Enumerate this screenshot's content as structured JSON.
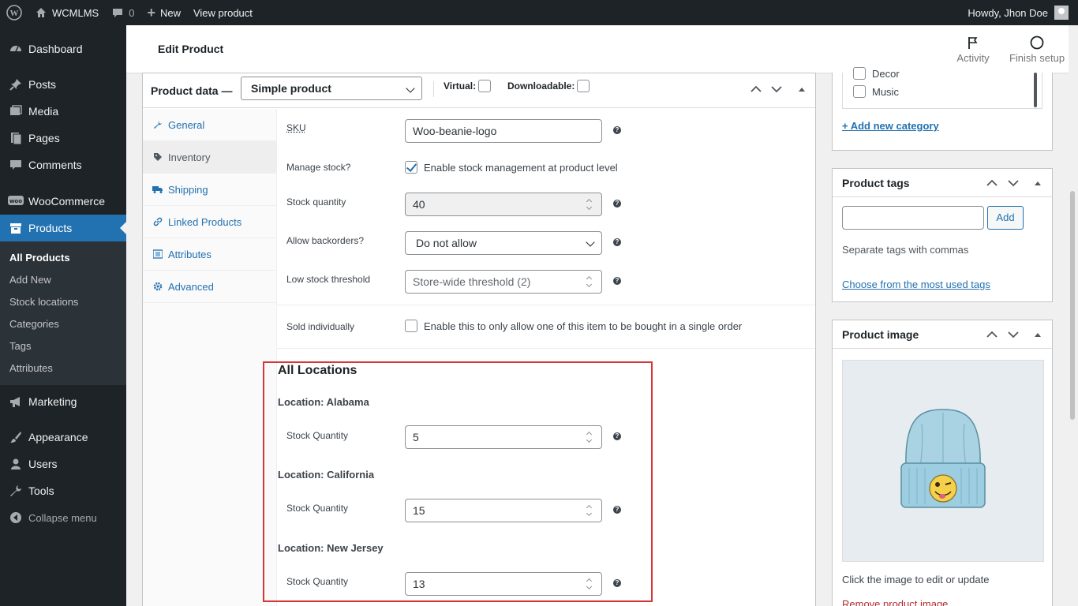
{
  "adminbar": {
    "site_name": "WCMLMS",
    "comments_count": "0",
    "new_label": "New",
    "view_product_label": "View product",
    "howdy": "Howdy, Jhon Doe"
  },
  "sidebar": {
    "items": [
      {
        "label": "Dashboard",
        "icon": "dashboard-icon"
      },
      {
        "label": "Posts",
        "icon": "pin-icon"
      },
      {
        "label": "Media",
        "icon": "media-icon"
      },
      {
        "label": "Pages",
        "icon": "pages-icon"
      },
      {
        "label": "Comments",
        "icon": "comment-icon"
      },
      {
        "label": "WooCommerce",
        "icon": "woo-icon"
      },
      {
        "label": "Products",
        "icon": "products-icon"
      },
      {
        "label": "Marketing",
        "icon": "megaphone-icon"
      },
      {
        "label": "Appearance",
        "icon": "brush-icon"
      },
      {
        "label": "Users",
        "icon": "user-icon"
      },
      {
        "label": "Tools",
        "icon": "wrench-icon"
      },
      {
        "label": "Collapse menu",
        "icon": "collapse-icon"
      }
    ],
    "submenu": [
      "All Products",
      "Add New",
      "Stock locations",
      "Categories",
      "Tags",
      "Attributes"
    ]
  },
  "header": {
    "title": "Edit Product",
    "activity_label": "Activity",
    "finish_setup_label": "Finish setup"
  },
  "product_data": {
    "title": "Product data —",
    "type_selected": "Simple product",
    "virtual_label": "Virtual:",
    "downloadable_label": "Downloadable:",
    "tabs": [
      "General",
      "Inventory",
      "Shipping",
      "Linked Products",
      "Attributes",
      "Advanced"
    ],
    "sku_label": "SKU",
    "sku_value": "Woo-beanie-logo",
    "manage_stock_label": "Manage stock?",
    "manage_stock_text": "Enable stock management at product level",
    "stock_qty_label": "Stock quantity",
    "stock_qty_value": "40",
    "backorders_label": "Allow backorders?",
    "backorders_value": "Do not allow",
    "low_stock_label": "Low stock threshold",
    "low_stock_placeholder": "Store-wide threshold (2)",
    "sold_ind_label": "Sold individually",
    "sold_ind_text": "Enable this to only allow one of this item to be bought in a single order",
    "all_locations_title": "All Locations",
    "locations": [
      {
        "name": "Location: Alabama",
        "qty_label": "Stock Quantity",
        "qty": "5"
      },
      {
        "name": "Location: California",
        "qty_label": "Stock Quantity",
        "qty": "15"
      },
      {
        "name": "Location: New Jersey",
        "qty_label": "Stock Quantity",
        "qty": "13"
      }
    ]
  },
  "categories": {
    "items": [
      "Decor",
      "Music"
    ],
    "add_new_link": "+ Add new category"
  },
  "tags": {
    "title": "Product tags",
    "add_button": "Add",
    "hint": "Separate tags with commas",
    "choose_link": "Choose from the most used tags"
  },
  "product_image": {
    "title": "Product image",
    "hint": "Click the image to edit or update",
    "remove_link": "Remove product image"
  }
}
